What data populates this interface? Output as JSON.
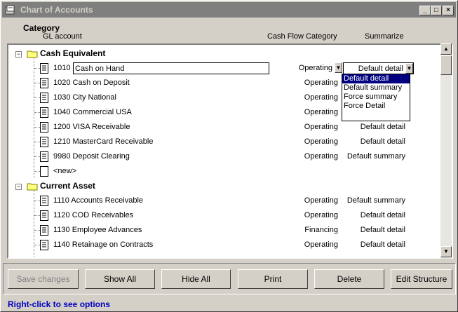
{
  "window": {
    "title": "Chart of Accounts"
  },
  "headers": {
    "category": "Category",
    "gl_account": "GL account",
    "cash_flow": "Cash Flow Category",
    "summarize": "Summarize"
  },
  "categories": [
    {
      "name": "Cash Equivalent",
      "expander": "−",
      "accounts": [
        {
          "number": "1010",
          "name": "Cash on Hand",
          "cash_flow": "Operating",
          "summarize": "Default detail"
        },
        {
          "label": "1020 Cash on Deposit",
          "cash_flow": "Operating",
          "summarize": ""
        },
        {
          "label": "1030 City National",
          "cash_flow": "Operating",
          "summarize": ""
        },
        {
          "label": "1040 Commercial USA",
          "cash_flow": "Operating",
          "summarize": ""
        },
        {
          "label": "1200 VISA Receivable",
          "cash_flow": "Operating",
          "summarize": "Default detail"
        },
        {
          "label": "1210 MasterCard Receivable",
          "cash_flow": "Operating",
          "summarize": "Default detail"
        },
        {
          "label": "9980 Deposit Clearing",
          "cash_flow": "Operating",
          "summarize": "Default summary"
        },
        {
          "label": "<new>",
          "cash_flow": "",
          "summarize": ""
        }
      ]
    },
    {
      "name": "Current Asset",
      "expander": "−",
      "accounts": [
        {
          "label": "1110 Accounts Receivable",
          "cash_flow": "Operating",
          "summarize": "Default summary"
        },
        {
          "label": "1120 COD Receivables",
          "cash_flow": "Operating",
          "summarize": "Default detail"
        },
        {
          "label": "1130 Employee Advances",
          "cash_flow": "Financing",
          "summarize": "Default detail"
        },
        {
          "label": "1140 Retainage on Contracts",
          "cash_flow": "Operating",
          "summarize": "Default detail"
        }
      ]
    }
  ],
  "summarize_options": [
    "Default detail",
    "Default summary",
    "Force summary",
    "Force Detail"
  ],
  "buttons": {
    "save": "Save changes",
    "show_all": "Show All",
    "hide_all": "Hide All",
    "print": "Print",
    "delete": "Delete",
    "edit_structure": "Edit Structure"
  },
  "status": "Right-click to see options",
  "colors": {
    "selection": "#000080",
    "status_text": "#0000c0"
  }
}
